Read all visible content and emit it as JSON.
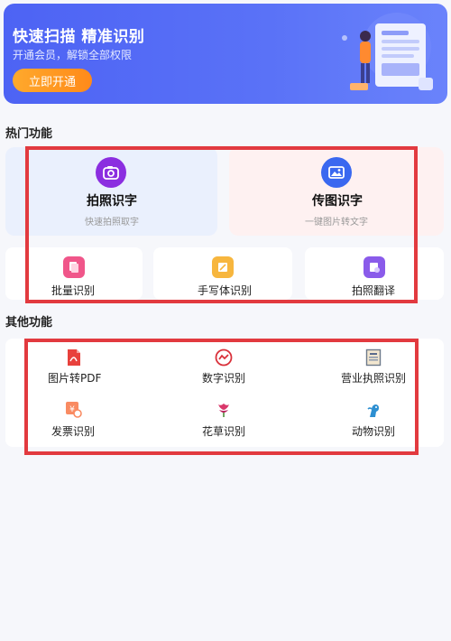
{
  "banner": {
    "title": "快速扫描 精准识别",
    "subtitle": "开通会员，解锁全部权限",
    "button": "立即开通"
  },
  "hot": {
    "title": "热门功能",
    "photo": {
      "label": "拍照识字",
      "sub": "快速拍照取字",
      "icon": "camera-icon"
    },
    "image": {
      "label": "传图识字",
      "sub": "一键图片转文字",
      "icon": "image-icon"
    },
    "small": [
      {
        "label": "批量识别",
        "icon": "batch-icon"
      },
      {
        "label": "手写体识别",
        "icon": "handwriting-icon"
      },
      {
        "label": "拍照翻译",
        "icon": "translate-icon"
      }
    ]
  },
  "other": {
    "title": "其他功能",
    "items": [
      {
        "label": "图片转PDF",
        "icon": "pdf-icon"
      },
      {
        "label": "数字识别",
        "icon": "chart-icon"
      },
      {
        "label": "营业执照识别",
        "icon": "license-icon"
      },
      {
        "label": "发票识别",
        "icon": "invoice-icon"
      },
      {
        "label": "花草识别",
        "icon": "flower-icon"
      },
      {
        "label": "动物识别",
        "icon": "animal-icon"
      }
    ]
  },
  "colors": {
    "banner": "#4d63f4",
    "button": "#ff9a22",
    "highlight": "#e23a3f",
    "camera": "#8b2ee0",
    "image": "#3a68f0"
  }
}
